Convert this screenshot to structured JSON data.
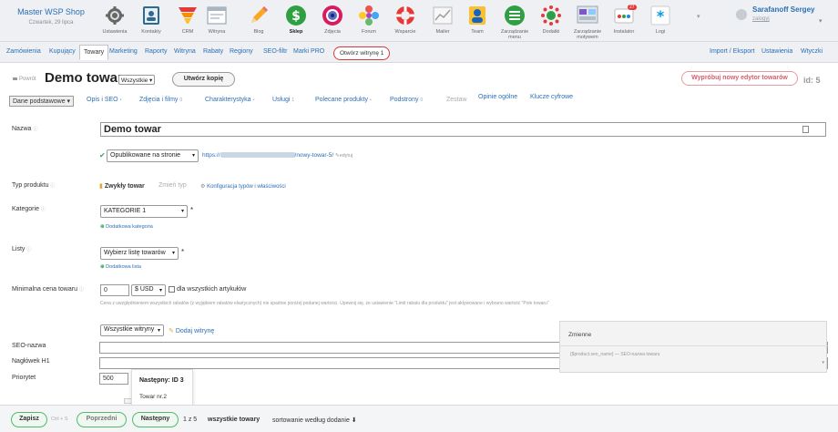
{
  "header": {
    "shop_name": "Master WSP Shop",
    "date": "Czwartek, 29 lipca",
    "tools": [
      {
        "label": "Ustawienia",
        "icon": "gear-icon"
      },
      {
        "label": "Kontakty",
        "icon": "contacts-icon"
      },
      {
        "label": "CRM",
        "icon": "funnel-icon"
      },
      {
        "label": "Witryna",
        "icon": "window-icon"
      },
      {
        "label": "Blog",
        "icon": "pencil-icon"
      },
      {
        "label": "Sklep",
        "icon": "dollar-icon"
      },
      {
        "label": "Zdjęcia",
        "icon": "camera-icon"
      },
      {
        "label": "Forum",
        "icon": "flower-icon"
      },
      {
        "label": "Wsparcie",
        "icon": "lifebuoy-icon"
      },
      {
        "label": "Mailer",
        "icon": "chart-icon"
      },
      {
        "label": "Team",
        "icon": "person-icon"
      },
      {
        "label": "Zarządzanie menu",
        "icon": "list-icon"
      },
      {
        "label": "Dodatki",
        "icon": "plugin-icon"
      },
      {
        "label": "Zarządzanie motywem",
        "icon": "theme-icon"
      },
      {
        "label": "Instalator",
        "icon": "installer-icon",
        "badge": "27"
      },
      {
        "label": "Logi",
        "icon": "asterisk-icon"
      }
    ],
    "user": {
      "name": "Sarafanoff Sergey",
      "link": "zalogyj"
    }
  },
  "nav": {
    "items": [
      "Zamówienia",
      "Kupujący",
      "Towary",
      "Marketing",
      "Raporty",
      "Witryna",
      "Rabaty",
      "Regiony",
      "SEO-filtr",
      "Marki PRO"
    ],
    "open_store": "Otwórz witrynę 1",
    "right": [
      "Import / Eksport",
      "Ustawienia",
      "Wtyczki"
    ]
  },
  "product": {
    "back": "Powrót",
    "title": "Demo towar",
    "scope": "Wszystkie",
    "copy_btn": "Utwórz kopię",
    "try_btn": "Wypróbuj nowy edytor towarów",
    "id": "id: 5"
  },
  "tabs": [
    {
      "label": "Dane podstawowe",
      "count": ""
    },
    {
      "label": "Opis i SEO",
      "count": "•"
    },
    {
      "label": "Zdjęcia i filmy",
      "count": "0"
    },
    {
      "label": "Charakterystyka",
      "count": "•"
    },
    {
      "label": "Usługi",
      "count": "1"
    },
    {
      "label": "Polecane produkty",
      "count": "•"
    },
    {
      "label": "Podstrony",
      "count": "0"
    },
    {
      "label": "Zestaw",
      "count": ""
    },
    {
      "label": "Opinie ogólne",
      "count": ""
    },
    {
      "label": "Klucze cyfrowe",
      "count": ""
    }
  ],
  "form": {
    "name_label": "Nazwa",
    "name_value": "Demo towar",
    "publish": "Opublikowane na stronie",
    "url_prefix": "https://",
    "url_suffix": "/nowy-towar-5/",
    "edit": "edytuj",
    "type_label": "Typ produktu",
    "type_value": "Zwykły towar",
    "type_change": "Zmień typ",
    "type_config": "Konfiguracja typów i właściwości",
    "cat_label": "Kategorie",
    "cat_value": "KATEGORIE 1",
    "cat_add": "Dodatkowa kategoria",
    "list_label": "Listy",
    "list_value": "Wybierz listę towarów",
    "list_add": "Dodatkowa lista",
    "minprice_label": "Minimalna cena towaru",
    "minprice_value": "0",
    "currency": "$ USD",
    "all_items": "dla wszystkich artykułów",
    "hint": "Cena z uwzględnieniem wszystkich rabatów (z wyjątkiem rabatów elastycznych) nie spadnie poniżej podanej wartości. Upewnij się, że ustawienie \"Limit rabatu dla produktu\" jest aktywowane i wybrano wartość \"Pole towaru\"",
    "storefronts": "Wszystkie witryny",
    "add_store": "Dodaj witrynę",
    "seo_label": "SEO-nazwa",
    "h1_label": "Nagłówek H1",
    "priority_label": "Priorytet",
    "priority_value": "500"
  },
  "variables": {
    "title": "Zmienne",
    "row": "{$product.seo_name} — SEO-nazwa towaru"
  },
  "tooltip": {
    "next": "Następny: ID 3",
    "item": "Towar nr.2"
  },
  "footer": {
    "save": "Zapisz",
    "shortcut": "Ctrl + S",
    "prev": "Poprzedni",
    "next": "Następny",
    "pager": "1 z 5",
    "filter": "wszystkie towary",
    "sort": "sortowanie według dodanie"
  }
}
